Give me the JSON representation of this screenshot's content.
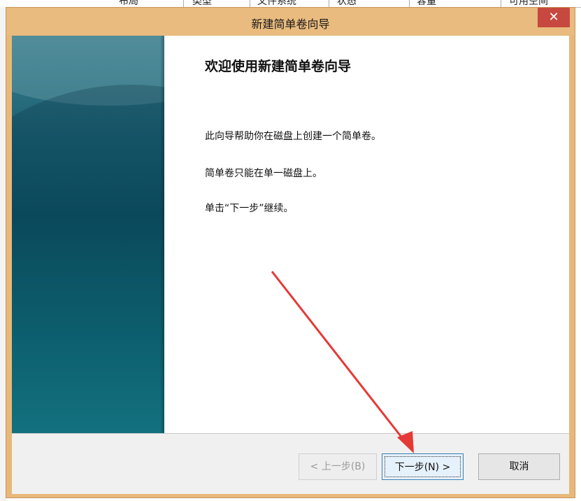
{
  "background": {
    "columns": [
      "布局",
      "类型",
      "文件系统",
      "状态",
      "容量",
      "可用空间"
    ]
  },
  "dialog": {
    "title": "新建简单卷向导",
    "close_glyph": "✕",
    "heading": "欢迎使用新建简单卷向导",
    "lines": [
      "此向导帮助你在磁盘上创建一个简单卷。",
      "简单卷只能在单一磁盘上。",
      "单击“下一步”继续。"
    ],
    "buttons": {
      "back": "< 上一步(B)",
      "next": "下一步(N) >",
      "cancel": "取消"
    }
  },
  "colors": {
    "frame": "#e9bb7e",
    "close": "#c7483f",
    "banner": "#0e5466",
    "annotation_arrow": "#e53935"
  },
  "icons": {
    "close": "close-icon",
    "annotation": "red-arrow-annotation"
  }
}
